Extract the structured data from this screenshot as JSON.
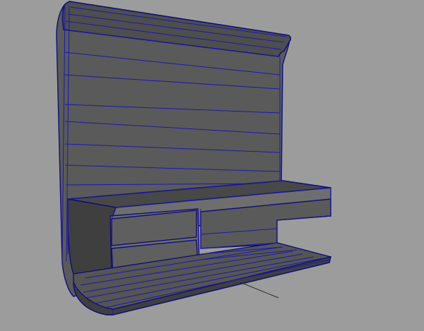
{
  "viewport": {
    "background_color": "#9c9c9c",
    "mesh_fill_color": "#5a5a5a",
    "mesh_dark_color": "#3f3f3f",
    "mesh_light_color": "#6e6e6e",
    "wireframe_color": "#1c1aa8",
    "wireframe_edge_color": "#0f0e7a",
    "pivot_line_color": "#2a2a2a"
  },
  "model": {
    "object_kind": "wall-unit-mesh",
    "back_panel_segments": 10,
    "base_plank_count": 6,
    "drawer_count": 2
  }
}
